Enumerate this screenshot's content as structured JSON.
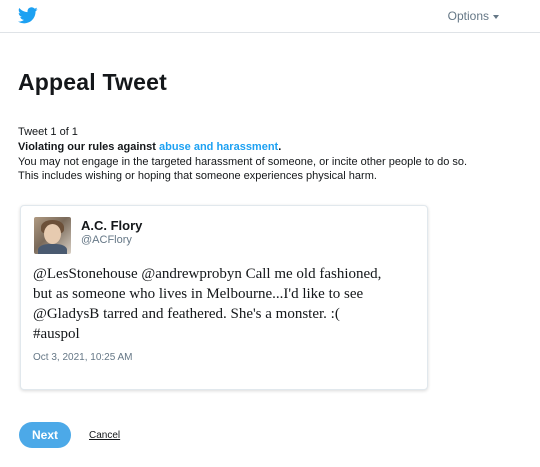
{
  "header": {
    "logo_icon": "twitter-bird-icon",
    "options_label": "Options",
    "options_icon": "caret-down-icon"
  },
  "page": {
    "title": "Appeal Tweet",
    "tweet_count": "Tweet 1 of 1",
    "rule_prefix": "Violating our rules against ",
    "rule_link": "abuse and harassment",
    "rule_suffix": ".",
    "description_line1": "You may not engage in the targeted harassment of someone, or incite other people to do so.",
    "description_line2": "This includes wishing or hoping that someone experiences physical harm."
  },
  "tweet": {
    "name": "A.C. Flory",
    "handle": "@ACFlory",
    "text_line1": "@LesStonehouse @andrewprobyn Call me old fashioned,",
    "text_line2": "but as someone who lives in Melbourne...I'd like to see",
    "text_line3": "@GladysB tarred and feathered. She's a monster. :(",
    "text_line4": "#auspol",
    "timestamp": "Oct 3, 2021, 10:25 AM"
  },
  "actions": {
    "next_label": "Next",
    "cancel_label": "Cancel"
  },
  "colors": {
    "brand_blue": "#1da1f2",
    "button_blue": "#4ca9e8",
    "muted_text": "#657786"
  }
}
